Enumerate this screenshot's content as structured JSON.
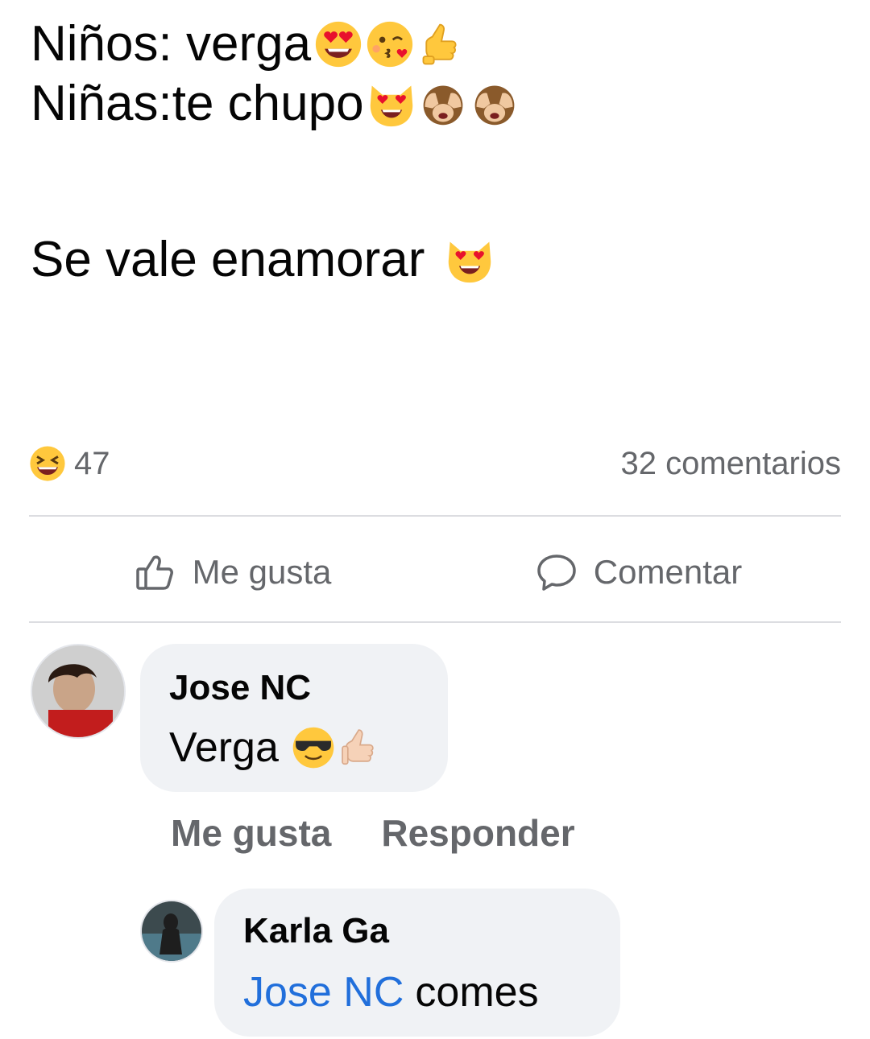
{
  "post": {
    "lines": [
      {
        "text": "Niños: verga",
        "emojis": [
          "heart-eyes-face-icon",
          "kiss-face-icon",
          "call-me-hand-icon"
        ]
      },
      {
        "text": "Niñas:te chupo",
        "emojis": [
          "heart-eyes-cat-icon",
          "see-no-evil-monkey-icon",
          "see-no-evil-monkey-icon"
        ]
      },
      {
        "text": "Se vale enamorar",
        "emojis": [
          "heart-eyes-cat-icon"
        ]
      }
    ]
  },
  "stats": {
    "reaction_icon": "laughing-face-icon",
    "reaction_count": "47",
    "comments_count": "32 comentarios"
  },
  "actions": {
    "like_label": "Me gusta",
    "comment_label": "Comentar"
  },
  "comments": [
    {
      "author": "Jose NC",
      "text": "Verga",
      "emojis": [
        "sunglasses-face-icon",
        "thumbs-up-icon"
      ],
      "like_label": "Me gusta",
      "reply_label": "Responder"
    },
    {
      "author": "Karla Ga",
      "mention": "Jose NC",
      "text": "comes"
    }
  ],
  "colors": {
    "text": "#050505",
    "muted": "#65676b",
    "bubble": "#f0f2f5",
    "mention": "#216fdb",
    "divider": "#dcdde1"
  }
}
